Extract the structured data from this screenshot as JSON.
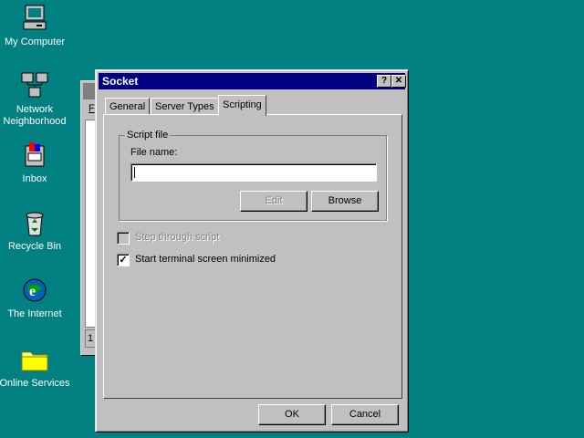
{
  "desktop": {
    "icons": [
      {
        "label": "My Computer",
        "icon": "computer-icon"
      },
      {
        "label": "Network Neighborhood",
        "icon": "network-icon"
      },
      {
        "label": "Inbox",
        "icon": "inbox-icon"
      },
      {
        "label": "Recycle Bin",
        "icon": "recycle-bin-icon"
      },
      {
        "label": "The Internet",
        "icon": "internet-icon"
      },
      {
        "label": "Online Services",
        "icon": "folder-icon"
      }
    ]
  },
  "bg_window": {
    "menu_letter": "F",
    "status_text": "1"
  },
  "dialog": {
    "title": "Socket",
    "help_button": "?",
    "close_button": "✕",
    "tabs": [
      "General",
      "Server Types",
      "Scripting"
    ],
    "active_tab": "Scripting",
    "script_group": {
      "legend": "Script file",
      "file_name_label": "File name:",
      "file_name_value": "",
      "edit_button": "Edit",
      "browse_button": "Browse"
    },
    "step_through": {
      "label": "Step through script",
      "checked": false,
      "enabled": false
    },
    "start_minimized": {
      "label": "Start terminal screen minimized",
      "checked": true,
      "enabled": true
    },
    "ok_button": "OK",
    "cancel_button": "Cancel"
  },
  "colors": {
    "desktop": "#008080",
    "titlebar": "#000080",
    "face": "#c0c0c0"
  }
}
